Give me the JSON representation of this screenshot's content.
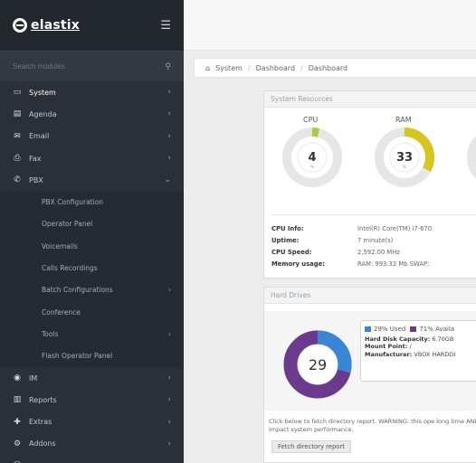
{
  "sidebar": {
    "logo_text": "elastix",
    "search_placeholder": "Search modules",
    "menu": [
      {
        "label": "System",
        "icon": "monitor",
        "arrow": "›"
      },
      {
        "label": "Agenda",
        "icon": "book",
        "arrow": "›"
      },
      {
        "label": "Email",
        "icon": "envelope",
        "arrow": "›"
      },
      {
        "label": "Fax",
        "icon": "printer",
        "arrow": "›"
      },
      {
        "label": "PBX",
        "icon": "phone",
        "arrow": "⌄"
      }
    ],
    "pbx_submenu": [
      {
        "label": "PBX Configuration",
        "arrow": ""
      },
      {
        "label": "Operator Panel",
        "arrow": ""
      },
      {
        "label": "Voicemails",
        "arrow": ""
      },
      {
        "label": "Calls Recordings",
        "arrow": ""
      },
      {
        "label": "Batch Configurations",
        "arrow": "›"
      },
      {
        "label": "Conference",
        "arrow": ""
      },
      {
        "label": "Tools",
        "arrow": "›"
      },
      {
        "label": "Flash Operator Panel",
        "arrow": ""
      }
    ],
    "menu_after": [
      {
        "label": "IM",
        "icon": "chat",
        "arrow": "›"
      },
      {
        "label": "Reports",
        "icon": "chart",
        "arrow": "›"
      },
      {
        "label": "Extras",
        "icon": "plus",
        "arrow": "›"
      },
      {
        "label": "Addons",
        "icon": "cogs",
        "arrow": "›"
      },
      {
        "label": "My Extension",
        "icon": "user",
        "arrow": "›"
      }
    ]
  },
  "breadcrumb": {
    "items": [
      "System",
      "Dashboard",
      "Dashboard"
    ]
  },
  "system_resources": {
    "title": "System Resources",
    "cpu": {
      "label": "CPU",
      "value": "4",
      "unit": "%",
      "percent": 4
    },
    "ram": {
      "label": "RAM",
      "value": "33",
      "unit": "%",
      "percent": 33
    },
    "info": [
      {
        "key": "CPU Info:",
        "value": "Intel(R) Core(TM) i7-670"
      },
      {
        "key": "Uptime:",
        "value": "7 minute(s)"
      },
      {
        "key": "CPU Speed:",
        "value": "2,592.00 MHz"
      },
      {
        "key": "Memory usage:",
        "value": "RAM: 993.32 Mb SWAP:"
      }
    ]
  },
  "hard_drives": {
    "title": "Hard Drives",
    "used_percent": 29,
    "center_value": "29",
    "legend_used": "29% Used",
    "legend_available": "71% Availa",
    "capacity_label": "Hard Disk Capacity:",
    "capacity_value": "6.70GB",
    "mount_label": "Mount Point:",
    "mount_value": "/",
    "manufacturer_label": "Manufacturer:",
    "manufacturer_value": "VBOX HARDDI",
    "note": "Click below to fetch directory report. WARNING: this ope long time AND impact system performance.",
    "button": "Fetch directory report"
  },
  "colors": {
    "cpu_fill": "#a8cf3a",
    "ram_fill": "#d9c31d",
    "disk_used": "#3a86d6",
    "disk_available": "#6b3a8f",
    "gauge_track": "#e6e6e6"
  }
}
